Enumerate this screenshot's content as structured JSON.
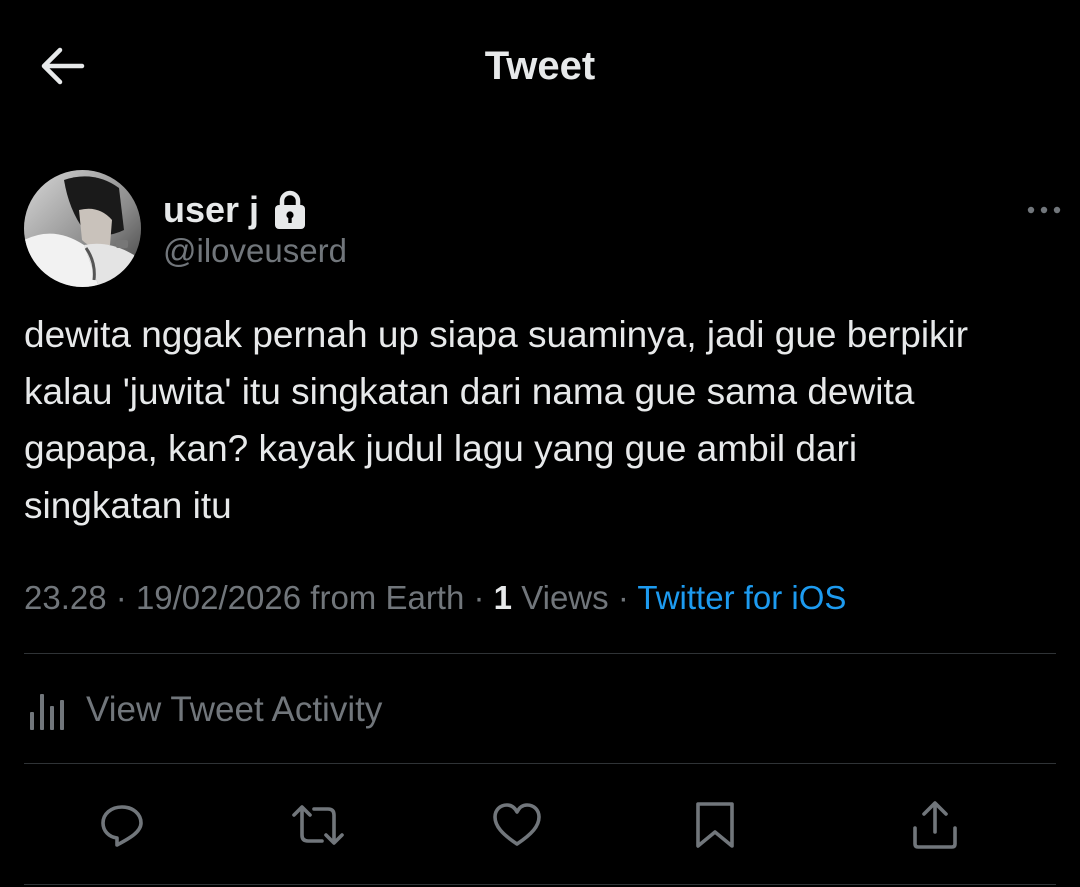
{
  "header": {
    "title": "Tweet",
    "back_icon": "arrow-left-icon"
  },
  "author": {
    "display_name": "user j",
    "handle": "@iloveuserd",
    "protected_icon": "lock-icon",
    "more_icon": "more-horizontal-icon"
  },
  "tweet": {
    "text": "dewita nggak pernah up siapa suaminya, jadi gue berpikir\nkalau 'juwita' itu singkatan dari nama gue sama dewita\ngapapa, kan? kayak judul lagu yang gue ambil dari\nsingkatan itu",
    "time": "23.28",
    "date": "19/02/2026",
    "location": "from Earth",
    "views_count": "1",
    "views_label": "Views",
    "source": "Twitter for iOS",
    "separator": "·"
  },
  "activity": {
    "label": "View Tweet Activity",
    "icon": "bar-chart-icon"
  },
  "actions": [
    {
      "name": "reply",
      "icon": "reply-icon"
    },
    {
      "name": "retweet",
      "icon": "retweet-icon"
    },
    {
      "name": "like",
      "icon": "heart-icon"
    },
    {
      "name": "bookmark",
      "icon": "bookmark-icon"
    },
    {
      "name": "share",
      "icon": "share-icon"
    }
  ],
  "colors": {
    "background": "#000000",
    "text": "#e7e9ea",
    "secondary": "#71767b",
    "accent": "#1d9bf0",
    "divider": "#2f3336"
  }
}
